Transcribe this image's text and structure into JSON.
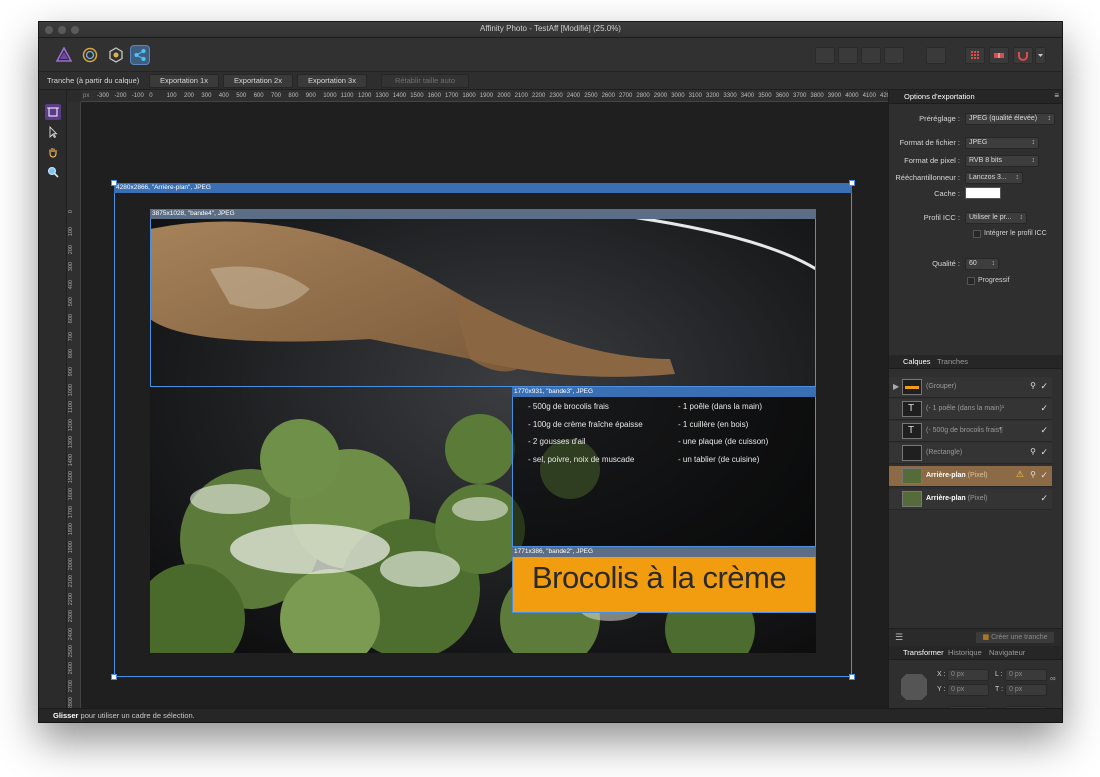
{
  "window": {
    "title": "Affinity Photo - TestAff [Modifié] (25.0%)"
  },
  "toolbar": {
    "personas": [
      "photo-persona-icon",
      "liquify-persona-icon",
      "develop-persona-icon",
      "export-persona-icon"
    ]
  },
  "context_bar": {
    "label": "Tranche (à partir du calque)",
    "buttons": [
      "Exportation 1x",
      "Exportation 2x",
      "Exportation 3x"
    ],
    "reset_button": "Rétablir taille auto"
  },
  "ruler": {
    "unit": "px",
    "top_ticks": [
      "-300",
      "-200",
      "-100",
      "0",
      "100",
      "200",
      "300",
      "400",
      "500",
      "600",
      "700",
      "800",
      "900",
      "1000",
      "1100",
      "1200",
      "1300",
      "1400",
      "1500",
      "1600",
      "1700",
      "1800",
      "1900",
      "2000",
      "2100",
      "2200",
      "2300",
      "2400",
      "2500",
      "2600",
      "2700",
      "2800",
      "2900",
      "3000",
      "3100",
      "3200",
      "3300",
      "3400",
      "3500",
      "3600",
      "3700",
      "3800",
      "3900",
      "4000",
      "4100",
      "4200"
    ],
    "left_ticks": [
      "0",
      "100",
      "200",
      "300",
      "400",
      "500",
      "600",
      "700",
      "800",
      "900",
      "1000",
      "1100",
      "1200",
      "1300",
      "1400",
      "1500",
      "1600",
      "1700",
      "1800",
      "1900",
      "2000",
      "2100",
      "2200",
      "2300",
      "2400",
      "2500",
      "2600",
      "2700",
      "2800",
      "2900",
      "3000"
    ]
  },
  "canvas": {
    "slices": {
      "arriere_plan": "4280x2866, \"Arrière-plan\", JPEG",
      "bande4": "3875x1028, \"bande4\", JPEG",
      "bande3": "1770x931, \"bande3\", JPEG",
      "bande2": "1771x386, \"bande2\", JPEG"
    },
    "ingredients_left": [
      "- 500g de brocolis frais",
      "- 100g de crème fraîche épaisse",
      "- 2 gousses d'ail",
      "- sel, poivre, noix de muscade"
    ],
    "ingredients_right": [
      "- 1 poêle (dans la main)",
      "- 1 cuillère (en bois)",
      "- une plaque (de cuisson)",
      "- un tablier (de cuisine)"
    ],
    "recipe_title": "Brocolis à la crème",
    "accent_color": "#f29c10"
  },
  "status": {
    "bold": "Glisser",
    "text": " pour utiliser un cadre de sélection."
  },
  "export_panel": {
    "tab": "Options d'exportation",
    "preset_label": "Préréglage :",
    "preset_value": "JPEG (qualité élevée)",
    "format_label": "Format de fichier :",
    "format_value": "JPEG",
    "pixel_label": "Format de pixel :",
    "pixel_value": "RVB 8 bits",
    "resample_label": "Rééchantillonneur :",
    "resample_value": "Lanczos 3...",
    "matte_label": "Cache :",
    "icc_label": "Profil ICC :",
    "icc_value": "Utiliser le pr...",
    "embed_icc": "Intégrer le profil ICC",
    "quality_label": "Qualité :",
    "quality_value": "60",
    "progressive": "Progressif"
  },
  "layers_panel": {
    "tabs": [
      "Calques",
      "Tranches"
    ],
    "layers": [
      {
        "name": "(Grouper)",
        "bold": ""
      },
      {
        "name": "(- 1 poêle (dans la main)¹",
        "bold": ""
      },
      {
        "name": "(- 500g de brocolis frais¶",
        "bold": ""
      },
      {
        "name": "(Rectangle)",
        "bold": ""
      },
      {
        "name": " (Pixel)",
        "bold": "Arrière-plan"
      },
      {
        "name": " (Pixel)",
        "bold": "Arrière-plan"
      }
    ],
    "create_slice": "Créer une tranche"
  },
  "transform_panel": {
    "tabs": [
      "Transformer",
      "Historique",
      "Navigateur"
    ],
    "fields": {
      "x_label": "X :",
      "x_value": "0 px",
      "y_label": "Y :",
      "y_value": "0 px",
      "l_label": "L :",
      "l_value": "0 px",
      "t_label": "T :",
      "t_value": "0 px",
      "r_label": "R :",
      "r_value": "0 °",
      "s_label": "S :",
      "s_value": "0 °"
    }
  }
}
